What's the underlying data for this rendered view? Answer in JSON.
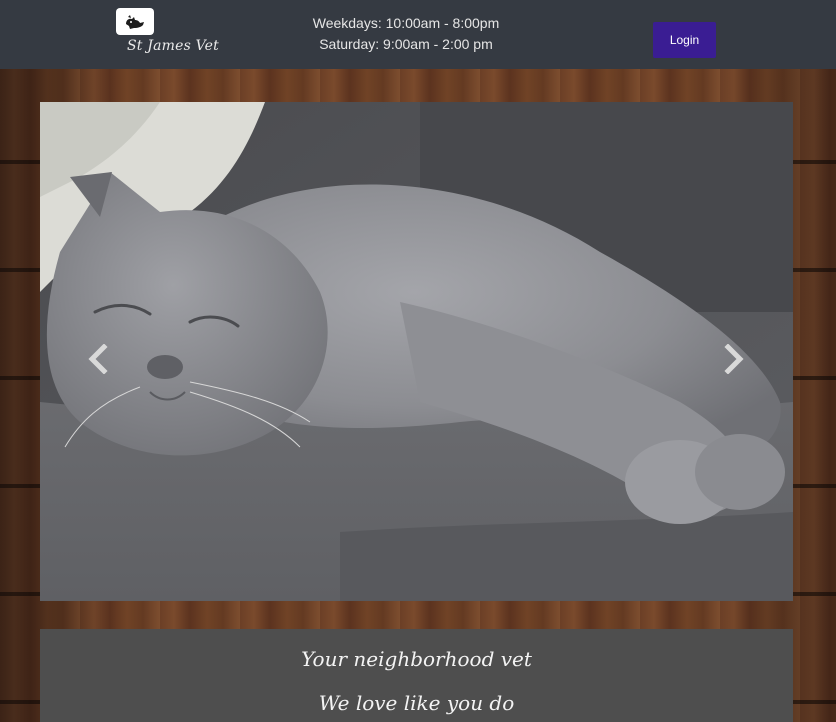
{
  "header": {
    "logo_icon": "pet-silhouette-icon",
    "brand_name": "St James Vet",
    "hours": {
      "weekdays": "Weekdays: 10:00am - 8:00pm",
      "saturday": "Saturday: 9:00am - 2:00 pm"
    },
    "login_label": "Login"
  },
  "carousel": {
    "image_subject": "grey-cat-sleeping-on-sofa",
    "prev_icon": "chevron-left-icon",
    "next_icon": "chevron-right-icon"
  },
  "tagline": {
    "line1": "Your neighborhood vet",
    "line2": "We love like you do"
  },
  "colors": {
    "header_bg": "#353a42",
    "login_button": "#3a1d93",
    "tagline_panel": "#4e4e4e"
  }
}
